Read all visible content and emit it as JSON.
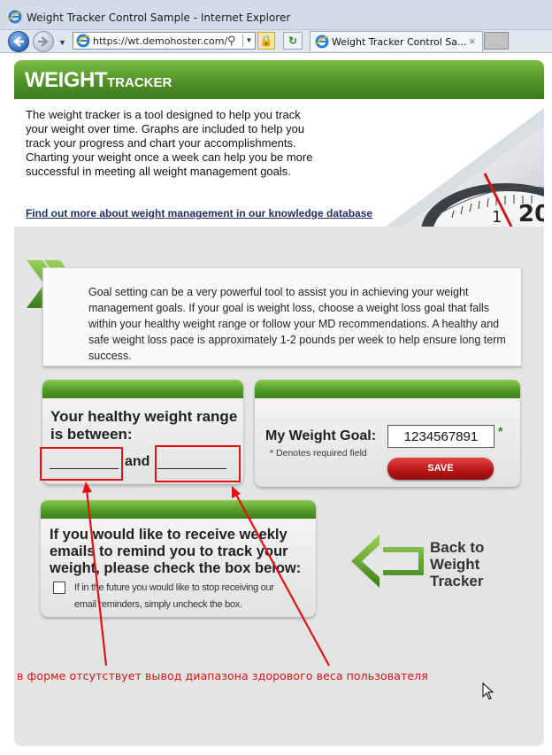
{
  "browser": {
    "window_title": "Weight Tracker Control Sample - Internet Explorer",
    "address_url": "https://wt.demohoster.com/",
    "tab_label": "Weight Tracker Control Sa...",
    "tab_close": "×"
  },
  "header": {
    "logo_big": "WEIGHT",
    "logo_small": "TRACKER"
  },
  "intro": {
    "text": "The weight tracker is a tool designed to help you track your weight over time. Graphs are included to help you track your progress and chart your accomplishments. Charting your weight once a week can help you be more successful in meeting all weight management goals.",
    "link": "Find out more about weight management in our knowledge database"
  },
  "goal_setting": {
    "text": "Goal setting can be a very powerful tool to assist you in achieving your weight management goals.  If your goal is weight loss, choose a weight loss goal that falls within your healthy weight range or follow your MD recommendations.  A healthy and safe weight loss pace is approximately 1-2 pounds per week to help ensure long term success."
  },
  "range_panel": {
    "heading": "Your healthy weight range is between:",
    "low_value": "",
    "and_label": "and",
    "high_value": ""
  },
  "goal_panel": {
    "label": "My Weight Goal:",
    "input_value": "1234567891",
    "required_star": "*",
    "required_note": "Denotes required field",
    "save_label": "SAVE"
  },
  "email_panel": {
    "heading": "If you would like to receive weekly emails to remind you to track your weight, please check the box below:",
    "note": "If in the future you would like to stop receiving our email reminders, simply uncheck the box.",
    "checked": false
  },
  "back_link": {
    "label": "Back to Weight Tracker"
  },
  "annotation": {
    "text": "в форме отсутствует вывод диапазона здорового веса пользователя",
    "color": "#d81010"
  },
  "colors": {
    "brand_green": "#549b28",
    "save_red": "#b71414",
    "link_blue": "#1d2f66"
  }
}
